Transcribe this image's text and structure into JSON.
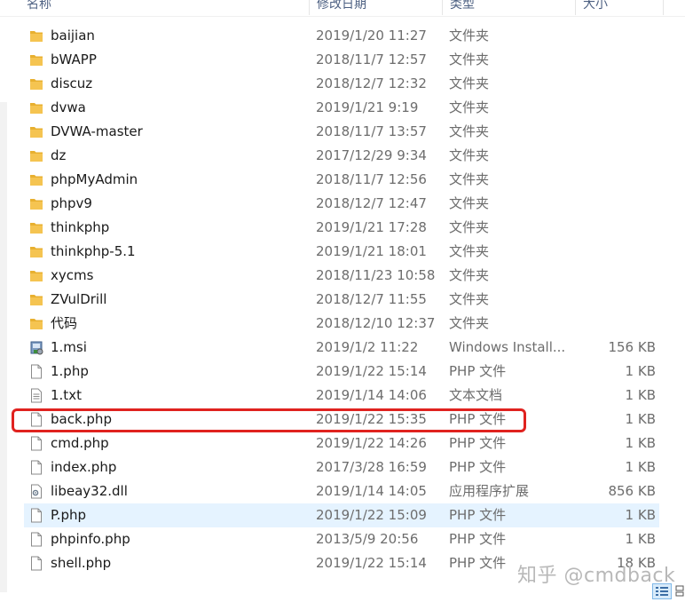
{
  "columns": {
    "name": "名称",
    "date": "修改日期",
    "type": "类型",
    "size": "大小"
  },
  "files": [
    {
      "name": "baijian",
      "date": "2019/1/20 11:27",
      "type": "文件夹",
      "size": "",
      "icon": "folder-icon"
    },
    {
      "name": "bWAPP",
      "date": "2018/11/7 12:57",
      "type": "文件夹",
      "size": "",
      "icon": "folder-icon"
    },
    {
      "name": "discuz",
      "date": "2018/12/7 12:32",
      "type": "文件夹",
      "size": "",
      "icon": "folder-icon"
    },
    {
      "name": "dvwa",
      "date": "2019/1/21 9:19",
      "type": "文件夹",
      "size": "",
      "icon": "folder-icon"
    },
    {
      "name": "DVWA-master",
      "date": "2018/11/7 13:57",
      "type": "文件夹",
      "size": "",
      "icon": "folder-icon"
    },
    {
      "name": "dz",
      "date": "2017/12/29 9:34",
      "type": "文件夹",
      "size": "",
      "icon": "folder-icon"
    },
    {
      "name": "phpMyAdmin",
      "date": "2018/11/7 12:56",
      "type": "文件夹",
      "size": "",
      "icon": "folder-icon"
    },
    {
      "name": "phpv9",
      "date": "2018/12/7 12:47",
      "type": "文件夹",
      "size": "",
      "icon": "folder-icon"
    },
    {
      "name": "thinkphp",
      "date": "2019/1/21 17:28",
      "type": "文件夹",
      "size": "",
      "icon": "folder-icon"
    },
    {
      "name": "thinkphp-5.1",
      "date": "2019/1/21 18:01",
      "type": "文件夹",
      "size": "",
      "icon": "folder-icon"
    },
    {
      "name": "xycms",
      "date": "2018/11/23 10:58",
      "type": "文件夹",
      "size": "",
      "icon": "folder-icon"
    },
    {
      "name": "ZVulDrill",
      "date": "2018/12/7 11:55",
      "type": "文件夹",
      "size": "",
      "icon": "folder-icon"
    },
    {
      "name": "代码",
      "date": "2018/12/10 12:37",
      "type": "文件夹",
      "size": "",
      "icon": "folder-icon"
    },
    {
      "name": "1.msi",
      "date": "2019/1/2 11:22",
      "type": "Windows Install...",
      "size": "156 KB",
      "icon": "installer-icon"
    },
    {
      "name": "1.php",
      "date": "2019/1/22 15:14",
      "type": "PHP 文件",
      "size": "1 KB",
      "icon": "file-icon"
    },
    {
      "name": "1.txt",
      "date": "2019/1/14 14:06",
      "type": "文本文档",
      "size": "1 KB",
      "icon": "text-file-icon"
    },
    {
      "name": "back.php",
      "date": "2019/1/22 15:35",
      "type": "PHP 文件",
      "size": "1 KB",
      "icon": "file-icon"
    },
    {
      "name": "cmd.php",
      "date": "2019/1/22 14:26",
      "type": "PHP 文件",
      "size": "1 KB",
      "icon": "file-icon"
    },
    {
      "name": "index.php",
      "date": "2017/3/28 16:59",
      "type": "PHP 文件",
      "size": "1 KB",
      "icon": "file-icon"
    },
    {
      "name": "libeay32.dll",
      "date": "2019/1/14 14:05",
      "type": "应用程序扩展",
      "size": "856 KB",
      "icon": "dll-icon"
    },
    {
      "name": "P.php",
      "date": "2019/1/22 15:09",
      "type": "PHP 文件",
      "size": "1 KB",
      "icon": "file-icon",
      "selected": true
    },
    {
      "name": "phpinfo.php",
      "date": "2013/5/9 20:56",
      "type": "PHP 文件",
      "size": "1 KB",
      "icon": "file-icon"
    },
    {
      "name": "shell.php",
      "date": "2019/1/22 15:14",
      "type": "PHP 文件",
      "size": "18 KB",
      "icon": "file-icon"
    }
  ],
  "watermark": "知乎 @cmdback",
  "colors": {
    "folder": "#f5c451",
    "selection": "#e5f3ff",
    "annotation": "#e0221f",
    "header_text": "#4d6082"
  }
}
